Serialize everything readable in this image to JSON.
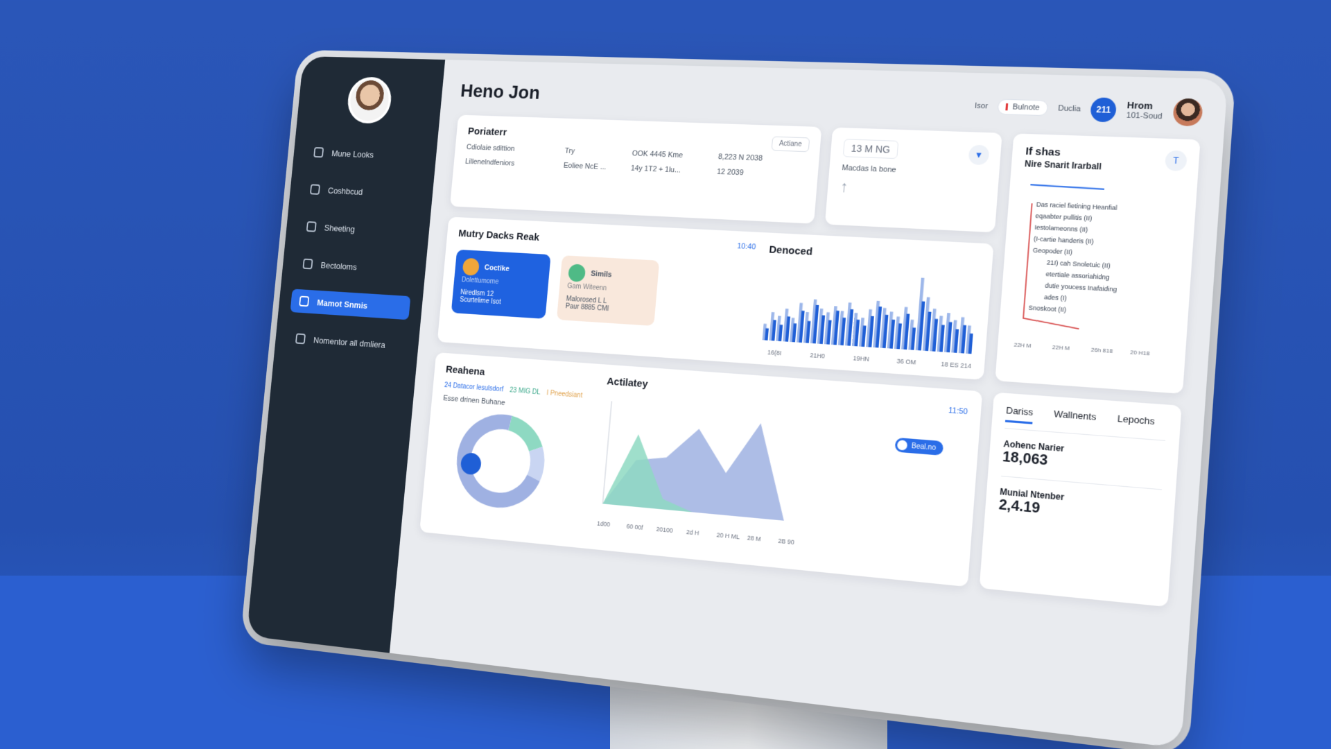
{
  "app": {
    "title": "Heno Jon"
  },
  "sidebar": {
    "items": [
      {
        "label": "Mune Looks",
        "active": false
      },
      {
        "label": "Coshbcud",
        "active": false
      },
      {
        "label": "Sheeting",
        "active": false
      },
      {
        "label": "Bectoloms",
        "active": false
      },
      {
        "label": "Mamot Snmis",
        "active": true
      },
      {
        "label": "Nomentor all dmliera",
        "active": false
      }
    ]
  },
  "header": {
    "pill1": "Isor",
    "pill2": "Bulnote",
    "pill3": "Duclia",
    "badge": "211",
    "user_name": "Hrom",
    "user_sub": "101-Soud"
  },
  "portfolio": {
    "title": "Poriaterr",
    "action": "Actiane",
    "rows": [
      [
        "Cdiolaie sdittion",
        "Try",
        "OOK 4445 Kme",
        "8,223 N 2038"
      ],
      [
        "Lillenelndfeniors",
        "Eoliee NcE ...",
        "14y 1T2 + 1lu...",
        "12 2039"
      ]
    ]
  },
  "stat": {
    "value": "13 M NG",
    "caption": "Macdas la bone"
  },
  "right_panel": {
    "title1": "If shas",
    "title2": "Nire Snarit Irarball",
    "lines": [
      "Das raciel fietining Heanfial",
      "eqaabter pullitis (II)",
      "Iestolameonns (II)",
      "(I-cartie handeris (II)",
      "Geopoder (II)",
      "21I) cah Snoletuic (II)",
      "etertiale assoriahidng",
      "dutie youcess Inafaiding",
      "ades (I)",
      "Snoskoot (II)"
    ],
    "x_labels": [
      "22H M",
      "22H M",
      "26h 818",
      "20 H18"
    ]
  },
  "decks": {
    "title": "Mutry Dacks Reak",
    "time": "10:40",
    "card1": {
      "title": "Coctike",
      "sub": "Dolettumome",
      "line1": "Niredlsm 12",
      "line2": "Scurtelime Isot"
    },
    "card2": {
      "title": "Simils",
      "sub": "Gam Witeenn",
      "line1": "Malorosed L L",
      "line2": "Paur 8885 CMI"
    }
  },
  "denoced": {
    "title": "Denoced",
    "x_labels": [
      "16(8I",
      "21H0",
      "19HN",
      "36 OM",
      "18 ES 214"
    ]
  },
  "reahena": {
    "title": "Reahena",
    "legend": [
      "24 Datacor lesulsdorf",
      "23 MIG DL",
      "I Pneedsiant"
    ],
    "sub": "Esse drinen Buhane"
  },
  "activity": {
    "title": "Actilatey",
    "time": "11:50",
    "toggle_label": "Beal.no",
    "x_labels": [
      "1d00",
      "60 00f",
      "20100",
      "2d H",
      "20 H ML",
      "28 M",
      "2B 90"
    ]
  },
  "tabs_panel": {
    "tabs": [
      "Dariss",
      "Wallnents",
      "Lepochs"
    ],
    "metric1_label": "Aohenc Narier",
    "metric1_value": "18,063",
    "metric2_label": "Munial Ntenber",
    "metric2_value": "2,4.19"
  },
  "chart_data": [
    {
      "type": "bar",
      "title": "Denoced",
      "categories": [
        "16(8I",
        "21H0",
        "19HN",
        "36 OM",
        "18 ES 214"
      ],
      "series": [
        {
          "values": [
            22,
            38,
            30,
            46,
            34,
            58,
            40,
            70,
            52,
            44,
            62,
            50,
            66,
            48,
            38,
            56,
            74,
            60,
            52,
            46,
            64,
            40,
            88,
            70,
            58,
            48,
            54,
            42,
            50,
            36
          ]
        },
        {
          "values": [
            30,
            52,
            46,
            60,
            44,
            72,
            56,
            80,
            64,
            58,
            70,
            62,
            78,
            60,
            52,
            68,
            84,
            72,
            66,
            58,
            76,
            54,
            130,
            96,
            76,
            64,
            70,
            58,
            64,
            50
          ]
        }
      ]
    },
    {
      "type": "pie",
      "title": "Reahena",
      "values": [
        16,
        12,
        72
      ]
    },
    {
      "type": "area",
      "title": "Actilatey",
      "series": [
        {
          "values": [
            0,
            70,
            10,
            0,
            0,
            0,
            0
          ]
        },
        {
          "values": [
            0,
            45,
            50,
            80,
            40,
            90,
            0
          ]
        }
      ],
      "x": [
        "1d00",
        "60 00f",
        "20100",
        "2d H",
        "20 H ML",
        "28 M",
        "2B 90"
      ]
    },
    {
      "type": "line",
      "title": "Nire Snarit Irarball",
      "x": [
        "22H M",
        "22H M",
        "26h 818",
        "20 H18"
      ]
    }
  ],
  "colors": {
    "accent": "#2a6de8",
    "sidebar": "#1f2a36",
    "bar_dark": "#1f5fd6",
    "bar_light": "#9db7ea",
    "mint": "#8ed9c2",
    "lavender": "#9fb1e2",
    "red_line": "#d33a3a"
  }
}
